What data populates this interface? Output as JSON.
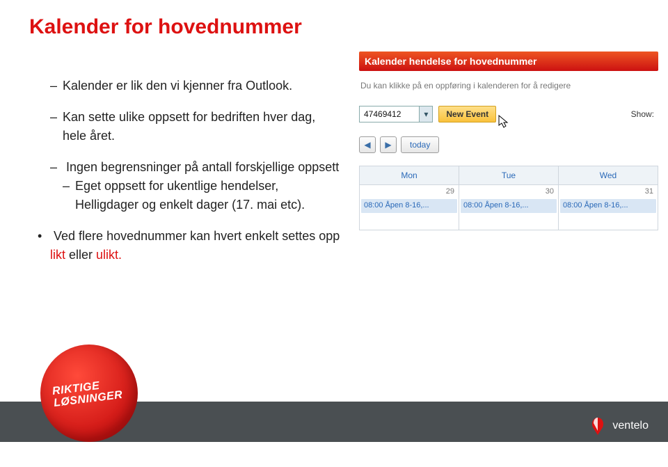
{
  "title": "Kalender for hovednummer",
  "bullets": {
    "b1": "Kalender er lik den vi kjenner fra Outlook.",
    "b2": "Kan sette ulike oppsett for bedriften hver dag, hele året.",
    "b3": "Ingen begrensninger på antall forskjellige oppsett",
    "b3a": "Eget oppsett for ukentlige hendelser, Helligdager og enkelt dager (17. mai etc).",
    "b4_pre": "Ved flere hovednummer kan hvert enkelt settes opp ",
    "b4_likt": "likt",
    "b4_mid": " eller ",
    "b4_ulikt": "ulikt."
  },
  "panel": {
    "header": "Kalender hendelse for hovednummer",
    "subtext": "Du kan klikke på en oppføring i kalenderen for å redigere",
    "select_value": "47469412",
    "new_event": "New Event",
    "show_label": "Show:",
    "today": "today",
    "days": {
      "mon": "Mon",
      "tue": "Tue",
      "wed": "Wed"
    },
    "nums": {
      "mon": "29",
      "tue": "30",
      "wed": "31"
    },
    "event_text": "08:00 Åpen 8-16,..."
  },
  "badge": {
    "line1": "RIKTIGE",
    "line2": "LØSNINGER"
  },
  "logo_text": "ventelo"
}
